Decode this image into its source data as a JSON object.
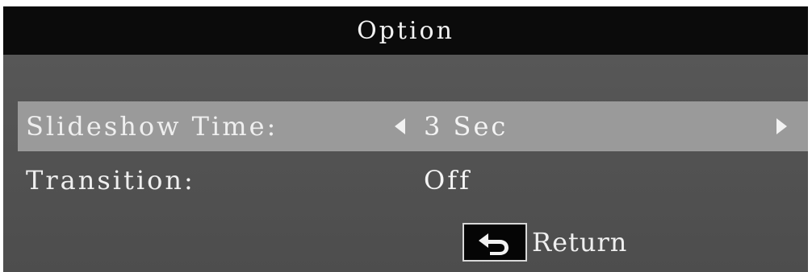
{
  "title": "Option",
  "options": [
    {
      "label": "Slideshow Time:",
      "value": "3 Sec",
      "selected": true
    },
    {
      "label": "Transition:",
      "value": "Off",
      "selected": false
    }
  ],
  "footer": {
    "return_label": "Return",
    "return_icon": "return-arrow-icon"
  },
  "colors": {
    "title_bar": "#0b0b0b",
    "background": "#555555",
    "selected_row": "#9a9a9a",
    "text": "#efefef"
  }
}
